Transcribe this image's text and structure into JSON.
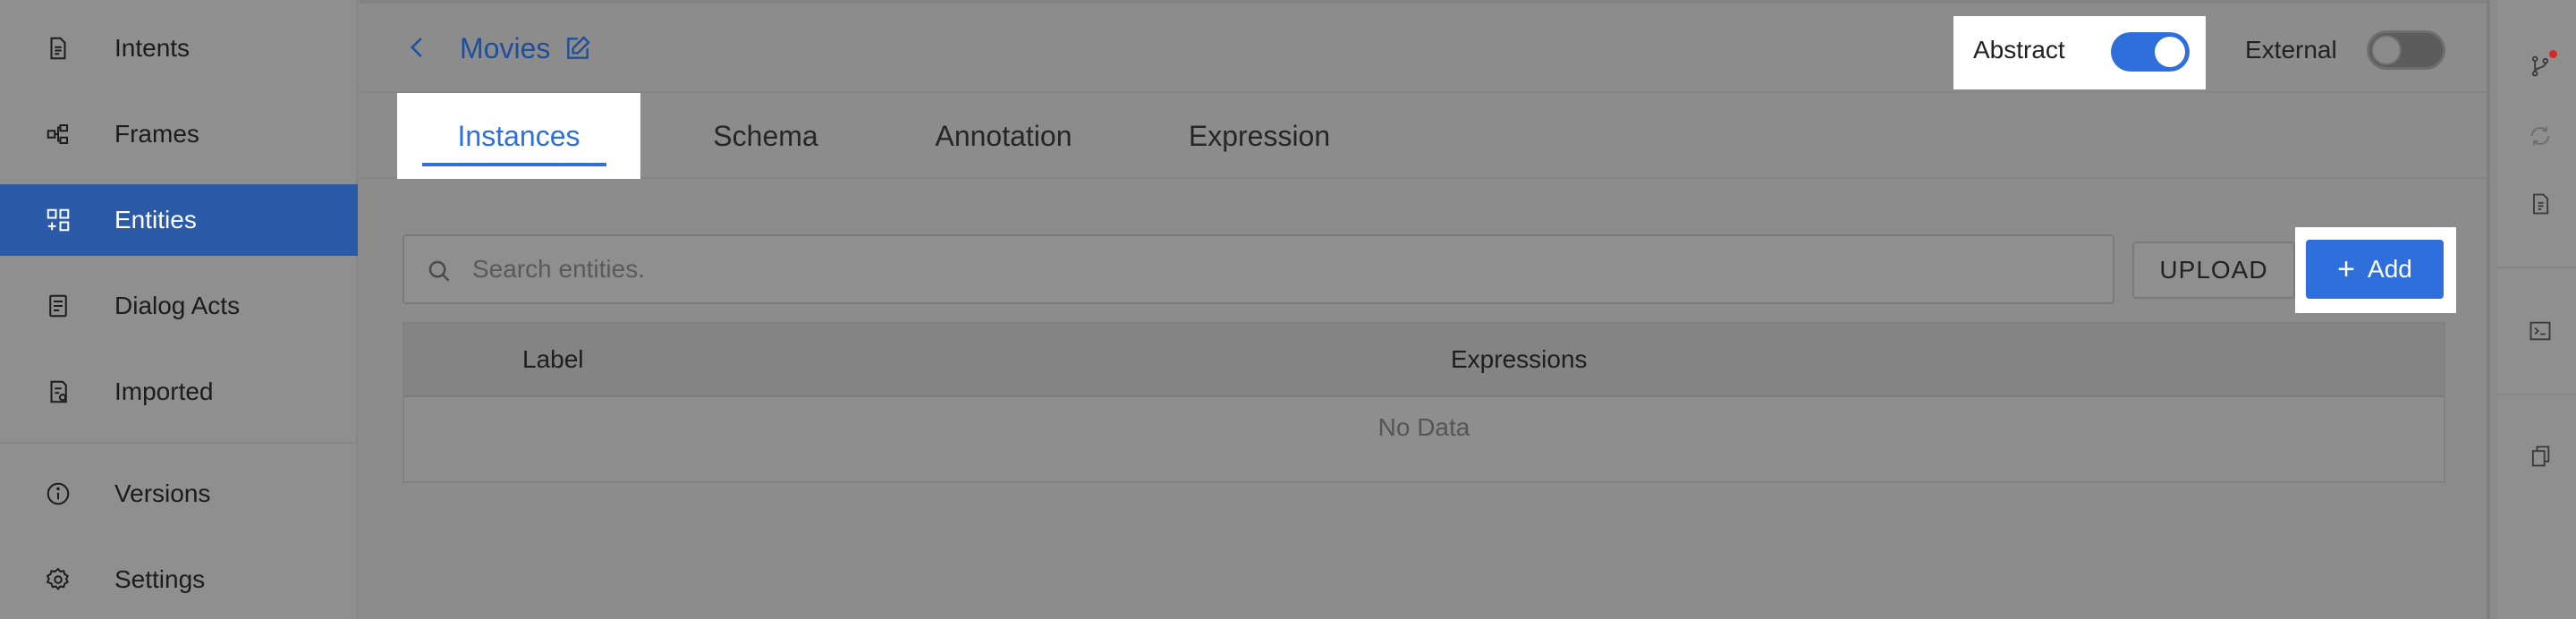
{
  "sidebar": {
    "items": [
      {
        "label": "Intents",
        "icon": "document-icon"
      },
      {
        "label": "Frames",
        "icon": "frames-icon"
      },
      {
        "label": "Entities",
        "icon": "entities-icon",
        "active": true
      },
      {
        "label": "Dialog Acts",
        "icon": "dialog-acts-icon"
      },
      {
        "label": "Imported",
        "icon": "imported-icon"
      }
    ],
    "bottom_items": [
      {
        "label": "Versions",
        "icon": "info-icon"
      },
      {
        "label": "Settings",
        "icon": "gear-icon"
      }
    ]
  },
  "header": {
    "title": "Movies",
    "abstract_label": "Abstract",
    "abstract_on": true,
    "external_label": "External",
    "external_on": false
  },
  "tabs": [
    {
      "label": "Instances",
      "active": true
    },
    {
      "label": "Schema"
    },
    {
      "label": "Annotation"
    },
    {
      "label": "Expression"
    }
  ],
  "search": {
    "placeholder": "Search entities."
  },
  "toolbar": {
    "upload_label": "UPLOAD",
    "add_label": "Add"
  },
  "table": {
    "columns": [
      "Label",
      "Expressions"
    ],
    "empty_text": "No Data"
  },
  "right_rail": {
    "icons": [
      "branch-icon",
      "refresh-icon",
      "doc-info-icon",
      "terminal-icon",
      "copy-icon"
    ]
  },
  "colors": {
    "accent": "#2f6fdb",
    "active_nav": "#2b5aa8",
    "notification_dot": "#d42a2a"
  }
}
